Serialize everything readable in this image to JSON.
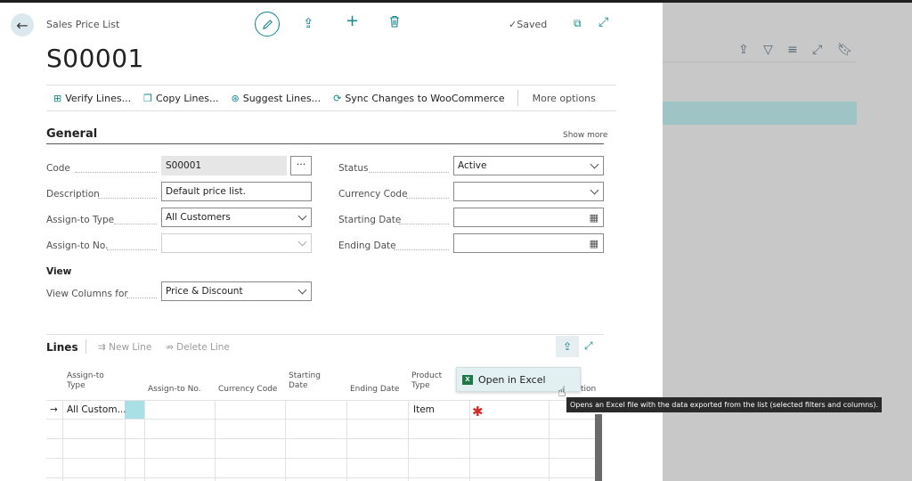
{
  "header": {
    "breadcrumb": "Sales Price List",
    "saved_label": "Saved",
    "title": "S00001"
  },
  "actions": [
    {
      "label": "Verify Lines...",
      "icon": "verify-icon"
    },
    {
      "label": "Copy Lines...",
      "icon": "copy-icon"
    },
    {
      "label": "Suggest Lines...",
      "icon": "suggest-icon"
    },
    {
      "label": "Sync Changes to WooCommerce",
      "icon": "sync-icon"
    }
  ],
  "more_options": "More options",
  "general": {
    "title": "General",
    "show_more": "Show more",
    "code_label": "Code",
    "code_value": "S00001",
    "assist_label": "···",
    "description_label": "Description",
    "description_value": "Default price list.",
    "assign_type_label": "Assign-to Type",
    "assign_type_value": "All Customers",
    "assign_no_label": "Assign-to No.",
    "assign_no_value": "",
    "status_label": "Status",
    "status_value": "Active",
    "currency_label": "Currency Code",
    "currency_value": "",
    "start_label": "Starting Date",
    "start_value": "",
    "end_label": "Ending Date",
    "end_value": ""
  },
  "view": {
    "title": "View",
    "columns_label": "View Columns for",
    "columns_value": "Price & Discount"
  },
  "lines": {
    "title": "Lines",
    "new_line": "New Line",
    "delete_line": "Delete Line",
    "columns": [
      "Assign-to Type",
      "Assign-to No.",
      "Currency Code",
      "Starting Date",
      "Ending Date",
      "Product Type"
    ],
    "partial_column": "tion",
    "row1": {
      "assign_type": "All Custom...",
      "product_type": "Item"
    }
  },
  "menu": {
    "open_in_excel": "Open in Excel",
    "tooltip": "Opens an Excel file with the data exported from the list (selected filters and columns)."
  }
}
